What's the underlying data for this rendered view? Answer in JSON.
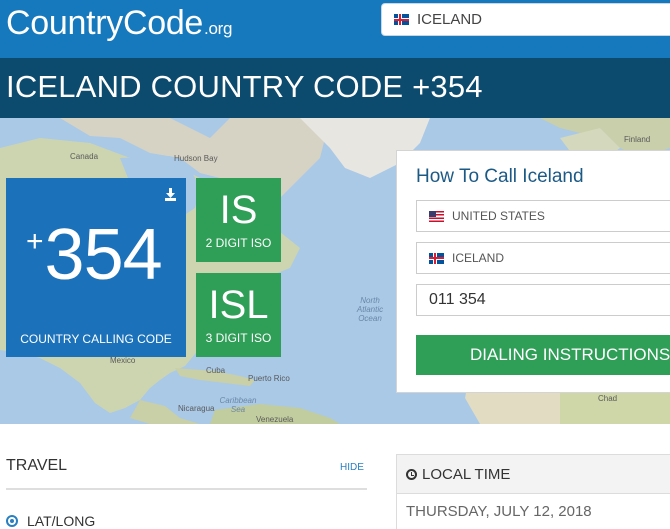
{
  "header": {
    "logo_main": "CountryCode",
    "logo_suffix": ".org",
    "country_select_value": "ICELAND"
  },
  "title": "ICELAND COUNTRY CODE +354",
  "map": {
    "labels": {
      "canada": "Canada",
      "hudson_bay": "Hudson Bay",
      "finland": "Finland",
      "north_atlantic_ocean": "North Atlantic Ocean",
      "mexico": "Mexico",
      "cuba": "Cuba",
      "puerto_rico": "Puerto Rico",
      "caribbean_sea": "Caribbean Sea",
      "nicaragua": "Nicaragua",
      "venezuela": "Venezuela",
      "chad": "Chad"
    }
  },
  "calling_code": {
    "plus": "+",
    "number": "354",
    "caption": "COUNTRY CALLING CODE"
  },
  "iso2": {
    "code": "IS",
    "label": "2 DIGIT ISO"
  },
  "iso3": {
    "code": "ISL",
    "label": "3 DIGIT ISO"
  },
  "how_to_call": {
    "title": "How To Call Iceland",
    "from_country": "UNITED STATES",
    "to_country": "ICELAND",
    "dial_string": "011 354",
    "button_label": "DIALING INSTRUCTIONS"
  },
  "travel": {
    "title": "TRAVEL",
    "hide_label": "HIDE",
    "latlong_label": "LAT/LONG"
  },
  "local_time": {
    "title": "LOCAL TIME",
    "date": "THURSDAY, JULY 12, 2018"
  },
  "colors": {
    "header_blue": "#1679bd",
    "title_band": "#0c4a6e",
    "code_blue": "#1b72ba",
    "iso_green": "#2f9e57"
  }
}
